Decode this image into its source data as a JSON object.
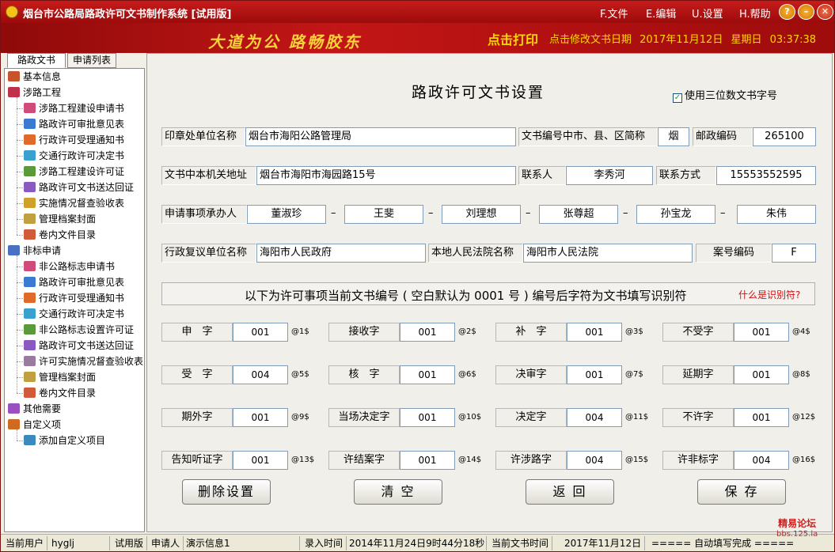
{
  "window": {
    "title": "烟台市公路局路政许可文书制作系统 [试用版]",
    "menus": [
      "F.文件",
      "E.编辑",
      "U.设置",
      "H.帮助"
    ],
    "controls": [
      "?",
      "–",
      "▢",
      "✕"
    ]
  },
  "banner": {
    "slogan": "大道为公  路畅胶东",
    "print_label": "点击打印",
    "date_label": "点击修改文书日期",
    "date": "2017年11月12日",
    "weekday": "星期日",
    "time": "03:37:38"
  },
  "sidebar": {
    "tabs": [
      "路政文书",
      "申请列表"
    ],
    "groups": [
      {
        "label": "基本信息",
        "color": "#c8542c"
      },
      {
        "label": "涉路工程",
        "color": "#c0304a"
      },
      {
        "label": "非标申请",
        "color": "#4a70c4"
      },
      {
        "label": "其他需要",
        "color": "#9b4fc0"
      },
      {
        "label": "自定义项",
        "color": "#d06a20"
      }
    ],
    "shelu_items": [
      {
        "label": "涉路工程建设申请书",
        "color": "#d04a7a"
      },
      {
        "label": "路政许可审批意见表",
        "color": "#3a7ad0"
      },
      {
        "label": "行政许可受理通知书",
        "color": "#e06a2a"
      },
      {
        "label": "交通行政许可决定书",
        "color": "#3aa0d0"
      },
      {
        "label": "涉路工程建设许可证",
        "color": "#5a9a3a"
      },
      {
        "label": "路政许可文书送达回证",
        "color": "#8a5ac0"
      },
      {
        "label": "实施情况督查验收表",
        "color": "#d0a02a"
      },
      {
        "label": "管理档案封面",
        "color": "#c0a040"
      },
      {
        "label": "卷内文件目录",
        "color": "#d05a3a"
      }
    ],
    "feibiao_items": [
      {
        "label": "非公路标志申请书",
        "color": "#d04a7a"
      },
      {
        "label": "路政许可审批意见表",
        "color": "#3a7ad0"
      },
      {
        "label": "行政许可受理通知书",
        "color": "#e06a2a"
      },
      {
        "label": "交通行政许可决定书",
        "color": "#3aa0d0"
      },
      {
        "label": "非公路标志设置许可证",
        "color": "#5a9a3a"
      },
      {
        "label": "路政许可文书送达回证",
        "color": "#8a5ac0"
      },
      {
        "label": "许可实施情况督查验收表",
        "color": "#9a7aa0"
      },
      {
        "label": "管理档案封面",
        "color": "#c0a040"
      },
      {
        "label": "卷内文件目录",
        "color": "#d05a3a"
      }
    ],
    "custom_items": [
      {
        "label": "添加自定义项目",
        "color": "#3a8ac0"
      }
    ]
  },
  "form": {
    "heading": "路政许可文书设置",
    "checkbox_label": "使用三位数文书字号",
    "checkbox_mark": "✓",
    "seal_unit_label": "印章处单位名称",
    "seal_unit_value": "烟台市海阳公路管理局",
    "abbr_label": "文书编号中市、县、区简称",
    "abbr_value": "烟",
    "postcode_label": "邮政编码",
    "postcode_value": "265100",
    "address_label": "文书中本机关地址",
    "address_value": "烟台市海阳市海园路15号",
    "contact_label": "联系人",
    "contact_value": "李秀河",
    "phone_label": "联系方式",
    "phone_value": "15553552595",
    "handler_label": "申请事项承办人",
    "handlers": [
      "董淑珍",
      "王斐",
      "刘理想",
      "张尊超",
      "孙宝龙",
      "朱伟"
    ],
    "dash": "–",
    "review_label": "行政复议单位名称",
    "review_value": "海阳市人民政府",
    "court_label": "本地人民法院名称",
    "court_value": "海阳市人民法院",
    "case_label": "案号编码",
    "case_value": "F",
    "band_text": "以下为许可事项当前文书编号 ( 空白默认为 0001 号 ) 编号后字符为文书填写识别符",
    "band_link": "什么是识别符?",
    "codes": [
      {
        "label": "申　字",
        "value": "001",
        "suffix": "@1$"
      },
      {
        "label": "接收字",
        "value": "001",
        "suffix": "@2$"
      },
      {
        "label": "补　字",
        "value": "001",
        "suffix": "@3$"
      },
      {
        "label": "不受字",
        "value": "001",
        "suffix": "@4$"
      },
      {
        "label": "受　字",
        "value": "004",
        "suffix": "@5$"
      },
      {
        "label": "核　字",
        "value": "001",
        "suffix": "@6$"
      },
      {
        "label": "决审字",
        "value": "001",
        "suffix": "@7$"
      },
      {
        "label": "延期字",
        "value": "001",
        "suffix": "@8$"
      },
      {
        "label": "期外字",
        "value": "001",
        "suffix": "@9$"
      },
      {
        "label": "当场决定字",
        "value": "001",
        "suffix": "@10$"
      },
      {
        "label": "决定字",
        "value": "004",
        "suffix": "@11$"
      },
      {
        "label": "不许字",
        "value": "001",
        "suffix": "@12$"
      },
      {
        "label": "告知听证字",
        "value": "001",
        "suffix": "@13$"
      },
      {
        "label": "许结案字",
        "value": "001",
        "suffix": "@14$"
      },
      {
        "label": "许涉路字",
        "value": "004",
        "suffix": "@15$"
      },
      {
        "label": "许非标字",
        "value": "004",
        "suffix": "@16$"
      }
    ],
    "buttons": {
      "delete": "删除设置",
      "clear": "清 空",
      "back": "返 回",
      "save": "保 存"
    }
  },
  "status": {
    "user_label": "当前用户",
    "user": "hyglj",
    "edition": "试用版",
    "applicant_label": "申请人",
    "applicant": "演示信息1",
    "entry_label": "录入时间",
    "entry_time": "2014年11月24日9时44分18秒",
    "doc_time_label": "当前文书时间",
    "doc_time": "2017年11月12日",
    "autofill": "===== 自动填写完成 =====",
    "watermark": "精易论坛",
    "watermark_url": "bbs.125.la"
  }
}
